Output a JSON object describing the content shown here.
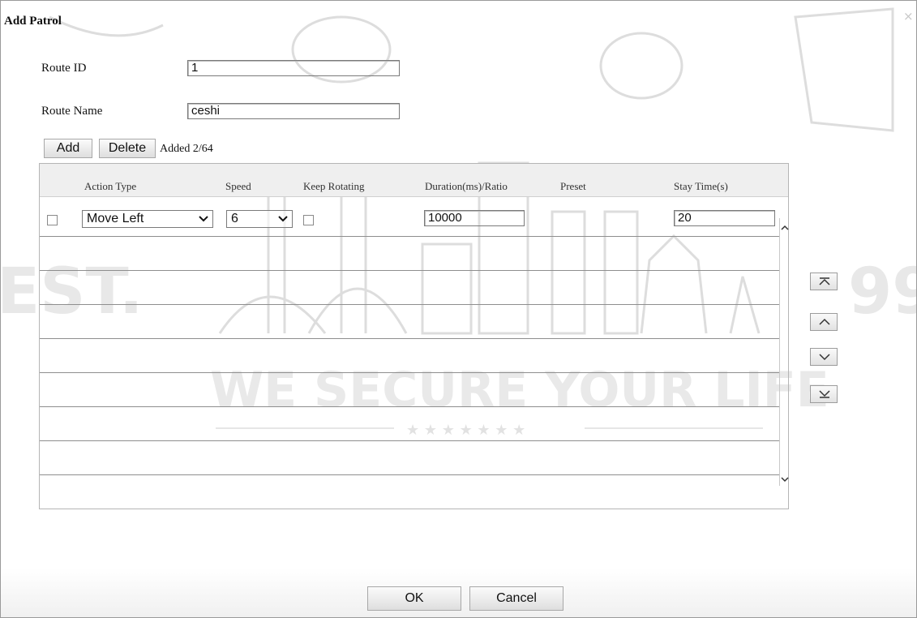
{
  "dialog": {
    "title": "Add Patrol",
    "close_glyph": "×"
  },
  "form": {
    "route_id_label": "Route ID",
    "route_id_value": "1",
    "route_name_label": "Route Name",
    "route_name_value": "ceshi"
  },
  "toolbar": {
    "add_label": "Add",
    "delete_label": "Delete",
    "added_count": "Added 2/64"
  },
  "table": {
    "columns": [
      "Action Type",
      "Speed",
      "Keep Rotating",
      "Duration(ms)/Ratio",
      "Preset",
      "Stay Time(s)"
    ],
    "rows": [
      {
        "checked": false,
        "action_type": "Move Left",
        "speed": "6",
        "keep_rotating": false,
        "duration": "10000",
        "preset": "",
        "stay_time": "20"
      }
    ],
    "empty_rows": 7
  },
  "move_buttons": [
    "move-top-icon",
    "move-up-icon",
    "move-down-icon",
    "move-bottom-icon"
  ],
  "footer": {
    "ok_label": "OK",
    "cancel_label": "Cancel"
  },
  "colors": {
    "border": "#9a9a9a",
    "header_bg": "#efefef",
    "row_line": "#8e8e8e",
    "watermark": "#e6e6e6"
  },
  "watermark": {
    "big_text": "WE SECURE YOUR LIFE",
    "est_text": "EST.",
    "year_text": "99",
    "stars": "★ ★ ★ ★ ★ ★ ★"
  }
}
